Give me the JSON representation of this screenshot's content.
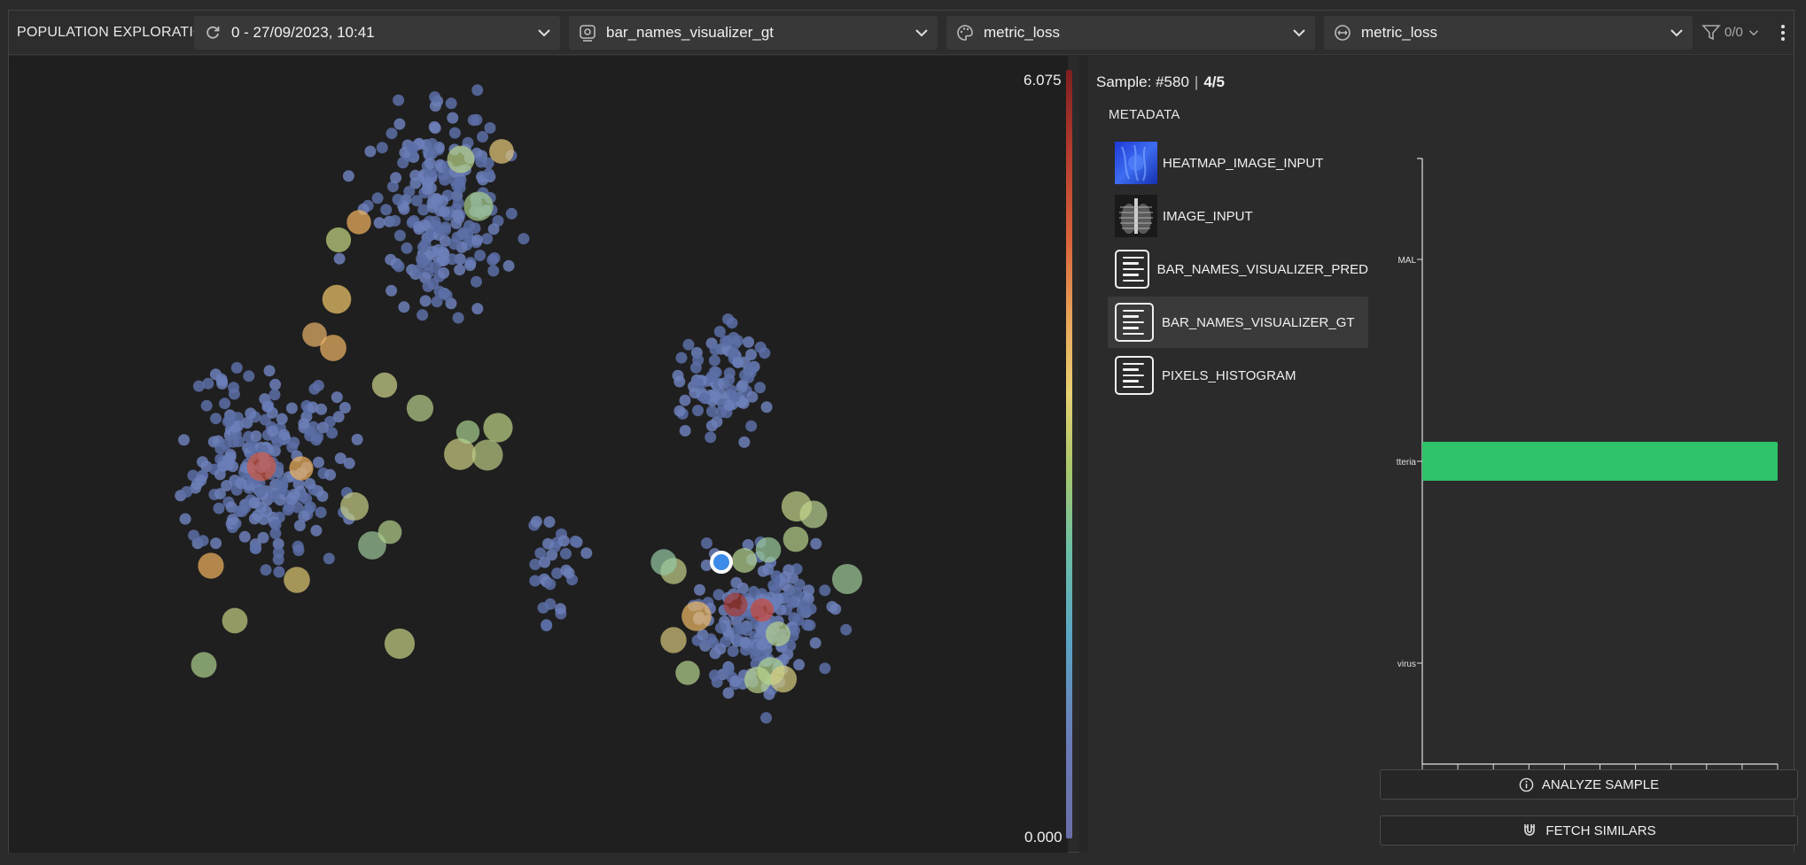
{
  "header": {
    "app_title": "POPULATION EXPLORATION",
    "session": {
      "label": "0 - 27/09/2023, 10:41",
      "icon": "refresh-icon"
    },
    "visualizer": {
      "label": "bar_names_visualizer_gt",
      "icon": "visualizer-icon"
    },
    "color_by": {
      "label": "metric_loss",
      "icon": "palette-icon"
    },
    "size_by": {
      "label": "metric_loss",
      "icon": "resize-icon"
    },
    "filter": {
      "count": "0/0",
      "icon": "filter-icon"
    }
  },
  "colorbar": {
    "max": "6.075",
    "min": "0.000"
  },
  "plot": {
    "description_points": "t-SNE style population scatter; colored by metric_loss",
    "selected_point_color": "#3d8be8"
  },
  "sample": {
    "prefix": "Sample: #580",
    "page": "4/5"
  },
  "metadata": {
    "title": "METADATA",
    "items": [
      {
        "label": "HEATMAP_IMAGE_INPUT",
        "kind": "heatmap"
      },
      {
        "label": "IMAGE_INPUT",
        "kind": "xray"
      },
      {
        "label": "BAR_NAMES_VISUALIZER_PRED",
        "kind": "text"
      },
      {
        "label": "BAR_NAMES_VISUALIZER_GT",
        "kind": "text",
        "selected": true
      },
      {
        "label": "PIXELS_HISTOGRAM",
        "kind": "text"
      }
    ]
  },
  "chart_data": {
    "type": "bar",
    "orientation": "horizontal",
    "categories": [
      "MAL",
      "tteria",
      "virus"
    ],
    "values": [
      0,
      1,
      0
    ],
    "bar_color": "#2ec26a",
    "xlim": [
      0,
      1
    ],
    "xticks": [
      "0",
      "0.1",
      "0.2",
      "0.3",
      "0.4",
      "0.5",
      "0.6",
      "0.7",
      "0.8",
      "0.9",
      "1"
    ],
    "grid": false
  },
  "actions": {
    "analyze": {
      "label": "ANALYZE SAMPLE",
      "icon": "info-icon"
    },
    "fetch": {
      "label": "FETCH SIMILARS",
      "icon": "magnet-icon"
    }
  }
}
